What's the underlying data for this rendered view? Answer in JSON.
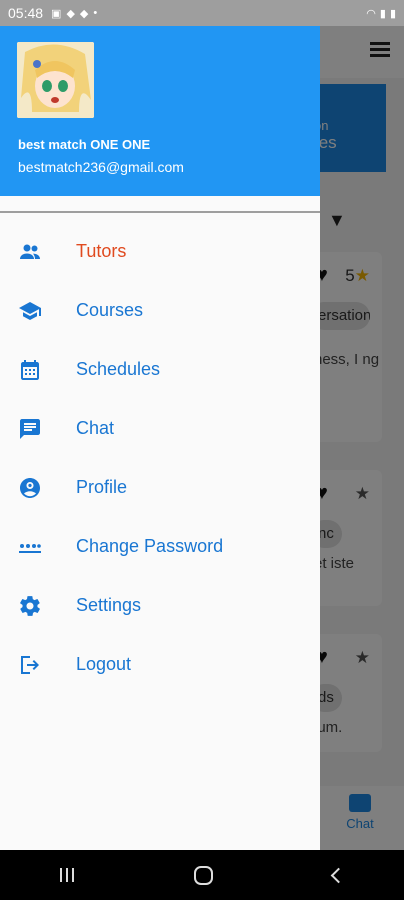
{
  "status_bar": {
    "time": "05:48"
  },
  "user": {
    "name": "best match ONE ONE",
    "email": "bestmatch236@gmail.com"
  },
  "menu": [
    {
      "label": "Tutors",
      "icon": "people-icon",
      "active": true
    },
    {
      "label": "Courses",
      "icon": "school-icon"
    },
    {
      "label": "Schedules",
      "icon": "calendar-icon"
    },
    {
      "label": "Chat",
      "icon": "chat-icon"
    },
    {
      "label": "Profile",
      "icon": "account-circle-icon"
    },
    {
      "label": "Change Password",
      "icon": "password-icon"
    },
    {
      "label": "Settings",
      "icon": "gear-icon"
    },
    {
      "label": "Logout",
      "icon": "logout-icon"
    }
  ],
  "background": {
    "banner_line1": "on",
    "banner_line2": "tes",
    "cards": [
      {
        "rating": "5",
        "chip": "ersation",
        "desc": "ness, I ng"
      },
      {
        "chip": "nc",
        "desc": "et iste"
      },
      {
        "chip": "ds",
        "desc": "lum."
      }
    ],
    "bottom_nav_label": "Chat"
  },
  "colors": {
    "header": "#2196f3",
    "menu_text": "#1976d2",
    "active_text": "#e04a1f"
  }
}
